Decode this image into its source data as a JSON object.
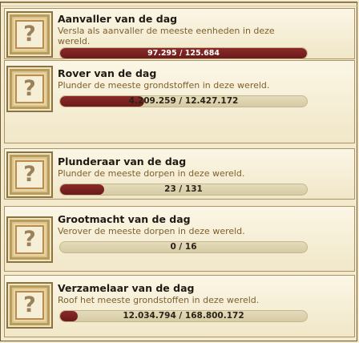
{
  "awards": [
    {
      "title": "Aanvaller van de dag",
      "description": "Versla als aanvaller de meeste eenheden in deze wereld.",
      "progress_text": "97.295 / 125.684",
      "progress": 1.0
    },
    {
      "title": "Rover van de dag",
      "description": "Plunder de meeste grondstoffen in deze wereld.",
      "progress_text": "4.209.259 / 12.427.172",
      "progress": 0.34
    },
    {
      "title": "Plunderaar van de dag",
      "description": "Plunder de meeste dorpen in deze wereld.",
      "progress_text": "23 / 131",
      "progress": 0.18
    },
    {
      "title": "Grootmacht van de dag",
      "description": "Verover de meeste dorpen in deze wereld.",
      "progress_text": "0 / 16",
      "progress": 0.0
    },
    {
      "title": "Verzamelaar van de dag",
      "description": "Roof het meeste grondstoffen in deze wereld.",
      "progress_text": "12.034.794 / 168.800.172",
      "progress": 0.07
    }
  ],
  "icon_glyph": "?",
  "colors": {
    "progress_fill": "#6b1a1a",
    "background": "#f4ebcf"
  }
}
